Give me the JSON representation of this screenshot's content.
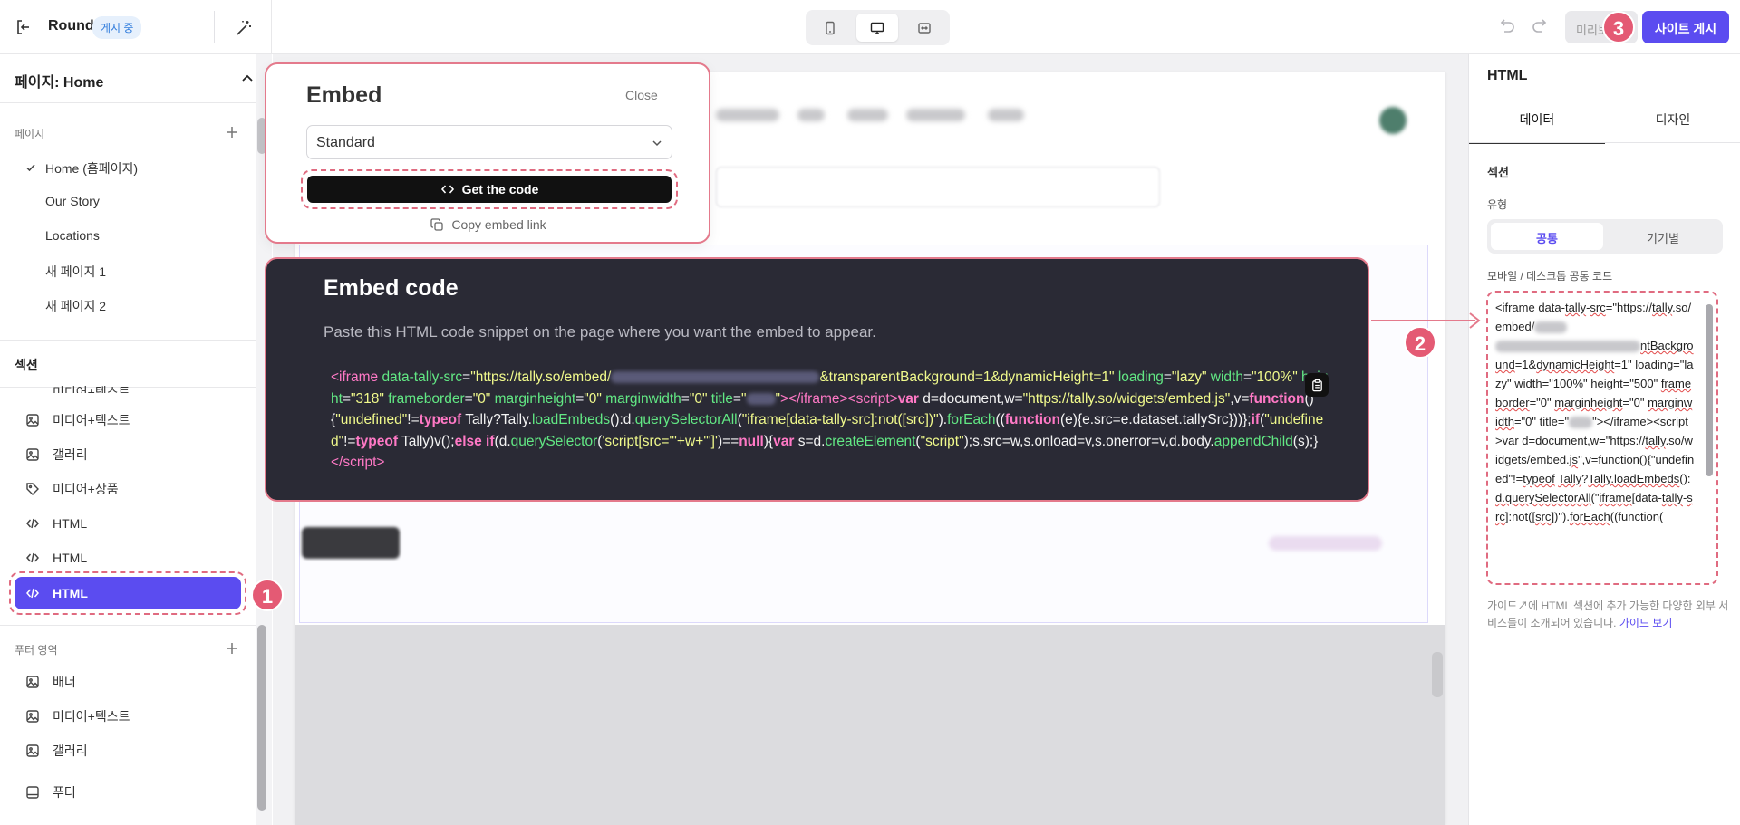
{
  "topbar": {
    "site_name": "Round",
    "status": "게시 중",
    "preview_label": "미리보기",
    "publish_label": "사이트 게시"
  },
  "sidebar": {
    "page_selector": "페이지: Home",
    "pages_heading": "페이지",
    "pages": [
      "Home (홈페이지)",
      "Our Story",
      "Locations",
      "새 페이지 1",
      "새 페이지 2"
    ],
    "sections_heading": "섹션",
    "sections": [
      {
        "label": "미디어+텍스트",
        "icon": "image-icon"
      },
      {
        "label": "미디어+텍스트",
        "icon": "image-icon"
      },
      {
        "label": "갤러리",
        "icon": "image-icon"
      },
      {
        "label": "미디어+상품",
        "icon": "tag-icon"
      },
      {
        "label": "HTML",
        "icon": "code-icon"
      },
      {
        "label": "HTML",
        "icon": "code-icon"
      },
      {
        "label": "HTML",
        "icon": "code-icon"
      }
    ],
    "footer_heading": "푸터 영역",
    "footer_items": [
      {
        "label": "배너",
        "icon": "image-icon"
      },
      {
        "label": "미디어+텍스트",
        "icon": "image-icon"
      },
      {
        "label": "갤러리",
        "icon": "image-icon"
      },
      {
        "label": "푸터",
        "icon": "footer-icon"
      }
    ]
  },
  "steps": [
    "1",
    "2",
    "3"
  ],
  "embed_modal": {
    "title": "Embed",
    "close": "Close",
    "select_value": "Standard",
    "get_code": "Get the code",
    "copy_link": "Copy embed link"
  },
  "code_panel": {
    "title": "Embed code",
    "description": "Paste this HTML code snippet on the page where you want the embed to appear."
  },
  "right_panel": {
    "title": "HTML",
    "tabs": [
      "데이터",
      "디자인"
    ],
    "section_label": "섹션",
    "type_label": "유형",
    "type_options": [
      "공통",
      "기기별"
    ],
    "code_label": "모바일 / 데스크톱 공통 코드",
    "guide_text": "가이드↗에 HTML 섹션에 추가 가능한 다양한 외부 서비스들이 소개되어 있습니다.",
    "guide_link": "가이드 보기"
  },
  "colors": {
    "accent": "#5b4cf0",
    "highlight": "#e45a74",
    "code_bg": "#2a2a35"
  }
}
